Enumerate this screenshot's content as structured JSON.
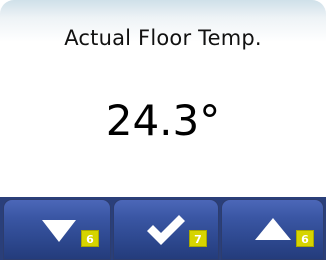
{
  "display": {
    "title": "Actual Floor Temp.",
    "reading": "24.3°"
  },
  "buttons": [
    {
      "icon": "arrow-down-icon",
      "badge": "6"
    },
    {
      "icon": "checkmark-icon",
      "badge": "7"
    },
    {
      "icon": "arrow-up-icon",
      "badge": "6"
    }
  ],
  "colors": {
    "button_blue": "#3a56a4",
    "badge_yellow": "#d6d400"
  }
}
